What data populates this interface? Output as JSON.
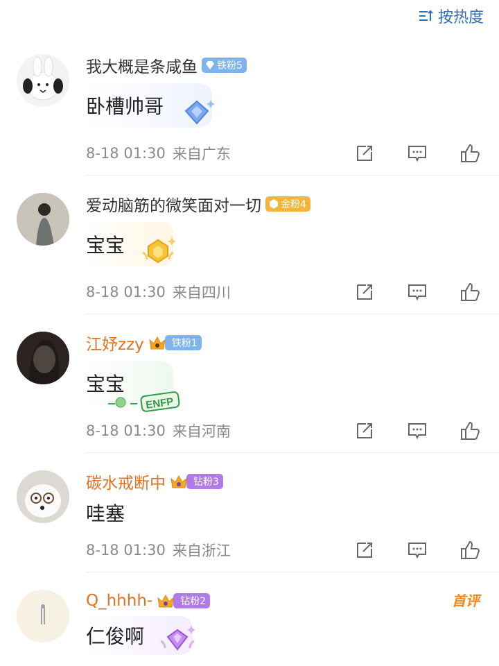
{
  "sort": {
    "label": "按热度",
    "icon": "sort-icon"
  },
  "colors": {
    "accent": "#2f6fb5",
    "orange_name": "#e0711f",
    "meta": "#8a8a8a"
  },
  "comments": [
    {
      "username": "我大概是条咸鱼",
      "badge": "铁粉5",
      "text": "卧槽帅哥",
      "date": "8-18 01:30",
      "location": "来自广东"
    },
    {
      "username": "爱动脑筋的微笑面对一切",
      "badge": "金粉4",
      "text": "宝宝",
      "date": "8-18 01:30",
      "location": "来自四川"
    },
    {
      "username": "江妤zzy",
      "badge": "铁粉1",
      "text": "宝宝",
      "date": "8-18 01:30",
      "location": "来自河南",
      "sticker": "ENFP"
    },
    {
      "username": "碳水戒断中",
      "badge": "钻粉3",
      "text": "哇塞",
      "date": "8-18 01:30",
      "location": "来自浙江"
    },
    {
      "username": "Q_hhhh-",
      "badge": "钻粉2",
      "text": "仁俊啊",
      "tag": "首评"
    }
  ]
}
